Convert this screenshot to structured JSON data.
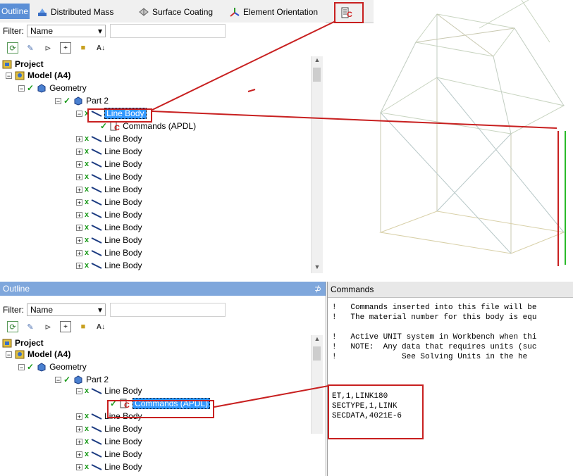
{
  "toolbar": {
    "outline_tab": "Outline",
    "distributed_mass": "Distributed Mass",
    "surface_coating": "Surface Coating",
    "element_orientation": "Element Orientation"
  },
  "top_outline": {
    "filter_label": "Filter:",
    "filter_value": "Name",
    "tree": {
      "project": "Project",
      "model": "Model (A4)",
      "geometry": "Geometry",
      "part": "Part 2",
      "selected_body": "Line Body",
      "commands": "Commands (APDL)",
      "bodies": [
        "Line Body",
        "Line Body",
        "Line Body",
        "Line Body",
        "Line Body",
        "Line Body",
        "Line Body",
        "Line Body",
        "Line Body",
        "Line Body",
        "Line Body"
      ]
    }
  },
  "bottom_outline": {
    "title": "Outline",
    "pin": "⊅",
    "filter_label": "Filter:",
    "filter_value": "Name",
    "tree": {
      "project": "Project",
      "model": "Model (A4)",
      "geometry": "Geometry",
      "part": "Part 2",
      "body": "Line Body",
      "commands_selected": "Commands (APDL)",
      "bodies": [
        "Line Body",
        "Line Body",
        "Line Body",
        "Line Body",
        "Line Body"
      ]
    }
  },
  "commands_panel": {
    "title": "Commands",
    "comment_lines": [
      "!   Commands inserted into this file will be",
      "!   The material number for this body is equ",
      "",
      "!   Active UNIT system in Workbench when thi",
      "!   NOTE:  Any data that requires units (suc",
      "!              See Solving Units in the he"
    ],
    "apdl_lines": [
      "ET,1,LINK180",
      "SECTYPE,1,LINK",
      "SECDATA,4021E-6"
    ]
  },
  "colors": {
    "highlight_red": "#c82020",
    "selection_blue": "#3399ff",
    "panel_header_blue": "#7fa7dc",
    "check_green": "#1a9a1a"
  }
}
